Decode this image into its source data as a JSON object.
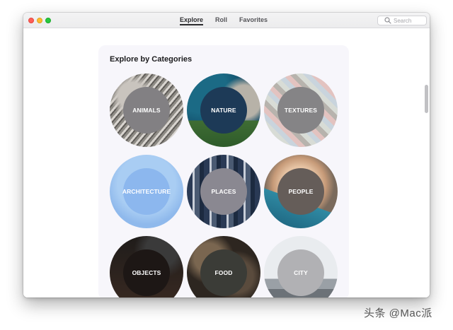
{
  "window": {
    "tabs": [
      {
        "label": "Explore",
        "active": true
      },
      {
        "label": "Roll",
        "active": false
      },
      {
        "label": "Favorites",
        "active": false
      }
    ],
    "search": {
      "placeholder": "Search",
      "icon": "search-icon"
    }
  },
  "explore": {
    "title": "Explore by Categories",
    "categories": [
      {
        "label": "ANIMALS",
        "center_color": "#828083"
      },
      {
        "label": "NATURE",
        "center_color": "#1d3a57"
      },
      {
        "label": "TEXTURES",
        "center_color": "#858486"
      },
      {
        "label": "ARCHITECTURE",
        "center_color": "#8cb7ee"
      },
      {
        "label": "PLACES",
        "center_color": "#8a8891"
      },
      {
        "label": "PEOPLE",
        "center_color": "#655d59"
      },
      {
        "label": "OBJECTS",
        "center_color": "#1d1715"
      },
      {
        "label": "FOOD",
        "center_color": "#3b3c37"
      },
      {
        "label": "CITY",
        "center_color": "#b1b1b4"
      }
    ]
  },
  "watermark": "头条 @Mac派",
  "colors": {
    "panel_bg": "#f7f6fb",
    "traffic_red": "#ff5f57",
    "traffic_yellow": "#febc2e",
    "traffic_green": "#28c840"
  }
}
